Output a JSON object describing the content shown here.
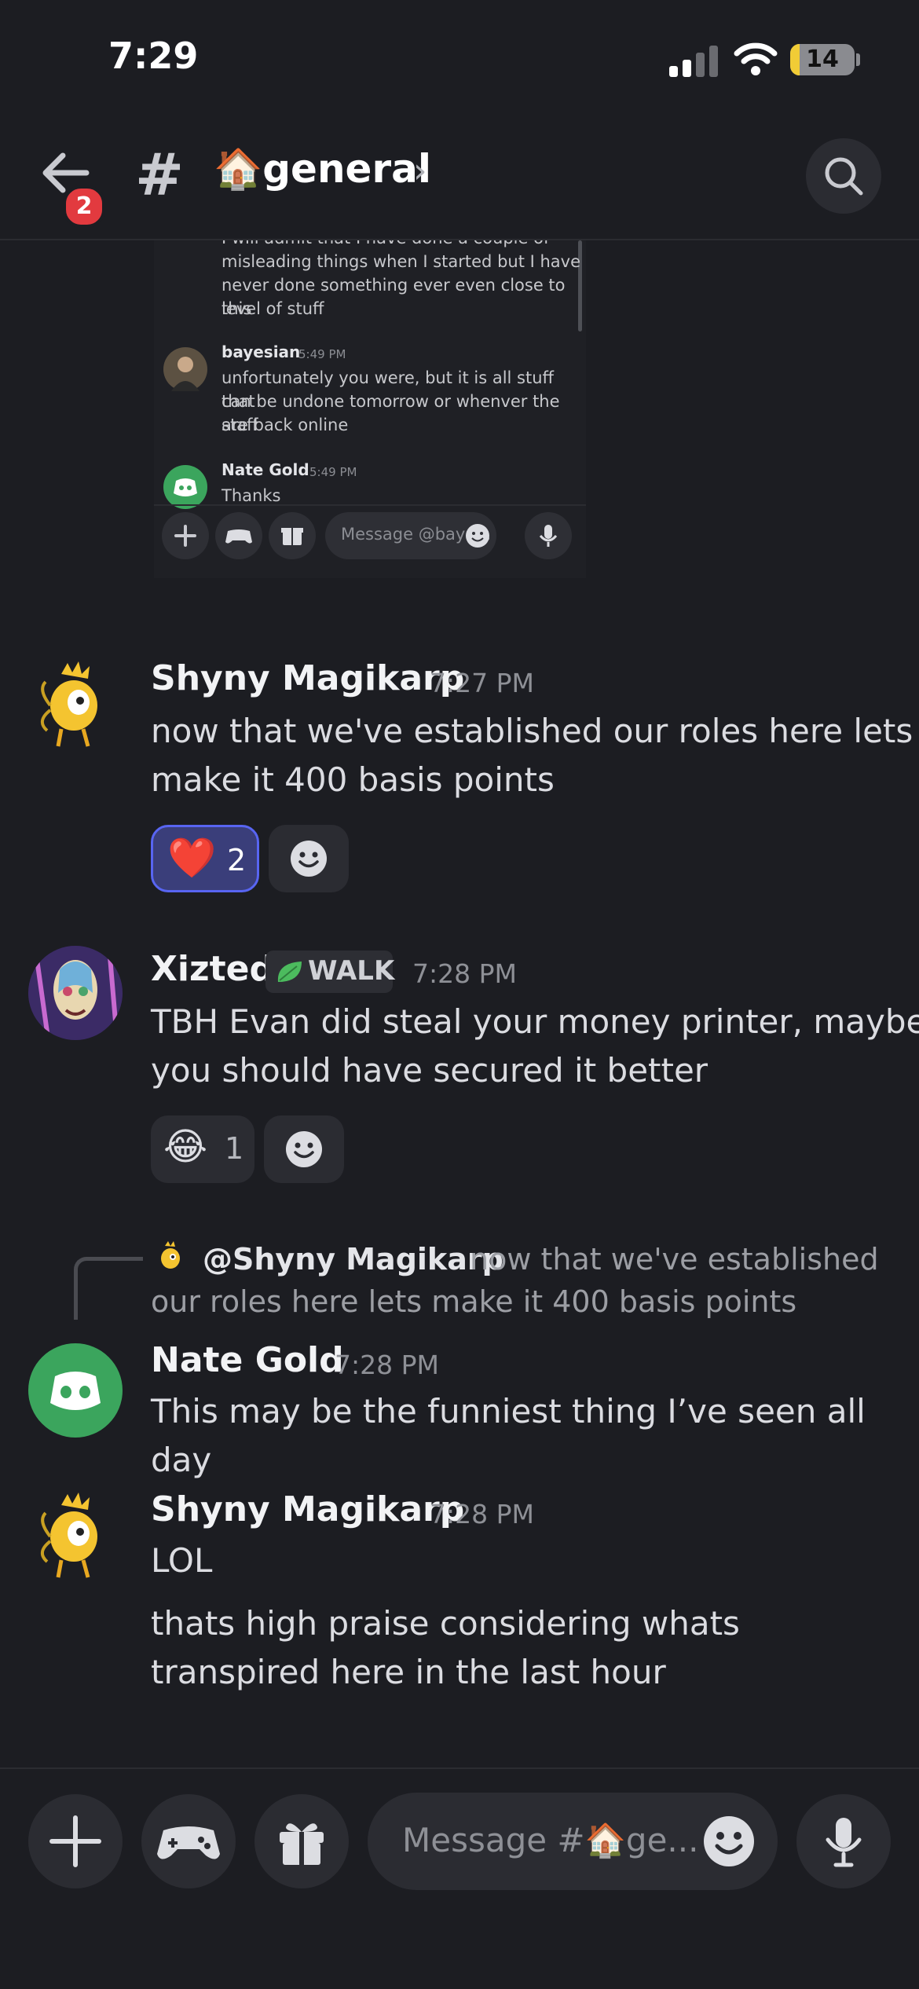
{
  "status_bar": {
    "time": "7:29",
    "battery": "14"
  },
  "header": {
    "back_badge": "2",
    "channel_name": "🏠general"
  },
  "screenshot": {
    "messages": [
      {
        "lines": [
          "I will admit that I have done a couple of",
          "misleading things when I started but I have",
          "never done something ever even close to this",
          "level of stuff"
        ]
      },
      {
        "author": "bayesian",
        "time": "5:49 PM",
        "lines": [
          "unfortunately you were, but it is all stuff that",
          "can be undone tomorrow or whenver the staff",
          "are back online"
        ]
      },
      {
        "author": "Nate Gold",
        "time": "5:49 PM",
        "lines": [
          "Thanks"
        ]
      }
    ],
    "input_placeholder": "Message @baye..."
  },
  "messages": [
    {
      "author": "Shyny Magikarp",
      "time": "7:27 PM",
      "lines": [
        "now that we've established our roles here lets",
        "make it 400 basis points"
      ],
      "reaction": {
        "emoji": "❤️",
        "count": "2"
      }
    },
    {
      "author": "Xizted",
      "tag": "WALK",
      "time": "7:28 PM",
      "lines": [
        "TBH Evan did steal your money printer, maybe",
        "you should have secured it better"
      ],
      "reaction": {
        "emoji": "😂",
        "count": "1"
      }
    },
    {
      "reply_to": "@Shyny Magikarp",
      "reply_line1": "now that we've established",
      "reply_line2": "our roles here lets make it 400 basis points",
      "author": "Nate Gold",
      "time": "7:28 PM",
      "lines": [
        "This may be the funniest thing I’ve seen all day"
      ]
    },
    {
      "author": "Shyny Magikarp",
      "time": "7:28 PM",
      "lines": [
        "LOL"
      ],
      "lines2": [
        "thats high praise considering whats",
        "transpired here in the last hour"
      ]
    }
  ],
  "composer": {
    "placeholder": "Message #🏠ge..."
  },
  "colors": {
    "background": "#1c1d22",
    "discord_green": "#3ba55d",
    "blurple": "#5865f2",
    "badge_red": "#e23a3f"
  }
}
